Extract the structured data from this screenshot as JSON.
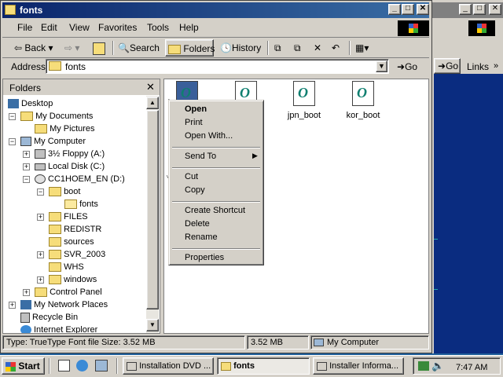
{
  "window": {
    "title": "fonts",
    "min": "_",
    "max": "□",
    "close": "✕"
  },
  "menu": [
    "File",
    "Edit",
    "View",
    "Favorites",
    "Tools",
    "Help"
  ],
  "toolbar": {
    "back": "Back",
    "search": "Search",
    "folders": "Folders",
    "history": "History"
  },
  "address": {
    "label": "Address",
    "value": "fonts",
    "go": "Go"
  },
  "background_window": {
    "go": "Go",
    "links": "Links"
  },
  "tree": {
    "header": "Folders",
    "items": [
      "Desktop",
      "My Documents",
      "My Pictures",
      "My Computer",
      "3½ Floppy (A:)",
      "Local Disk (C:)",
      "CC1HOEM_EN (D:)",
      "boot",
      "fonts",
      "FILES",
      "REDISTR",
      "sources",
      "SVR_2003",
      "WHS",
      "windows",
      "Control Panel",
      "My Network Places",
      "Recycle Bin",
      "Internet Explorer"
    ]
  },
  "files": [
    {
      "label": ""
    },
    {
      "label": ""
    },
    {
      "label": "jpn_boot"
    },
    {
      "label": "kor_boot"
    }
  ],
  "context_menu": {
    "open": "Open",
    "print": "Print",
    "open_with": "Open With...",
    "send_to": "Send To",
    "cut": "Cut",
    "copy": "Copy",
    "create_shortcut": "Create Shortcut",
    "delete": "Delete",
    "rename": "Rename",
    "properties": "Properties"
  },
  "status": {
    "type": "Type: TrueType Font file Size: 3.52 MB",
    "size": "3.52 MB",
    "location": "My Computer"
  },
  "taskbar": {
    "start": "Start",
    "tasks": [
      "Installation DVD ...",
      "fonts",
      "Installer Informa..."
    ],
    "time": "7:47 AM"
  },
  "colors": {
    "title_active": "#0a246a",
    "title_inactive": "#808080",
    "face": "#d4d0c8",
    "desktop": "#0a2c80"
  }
}
